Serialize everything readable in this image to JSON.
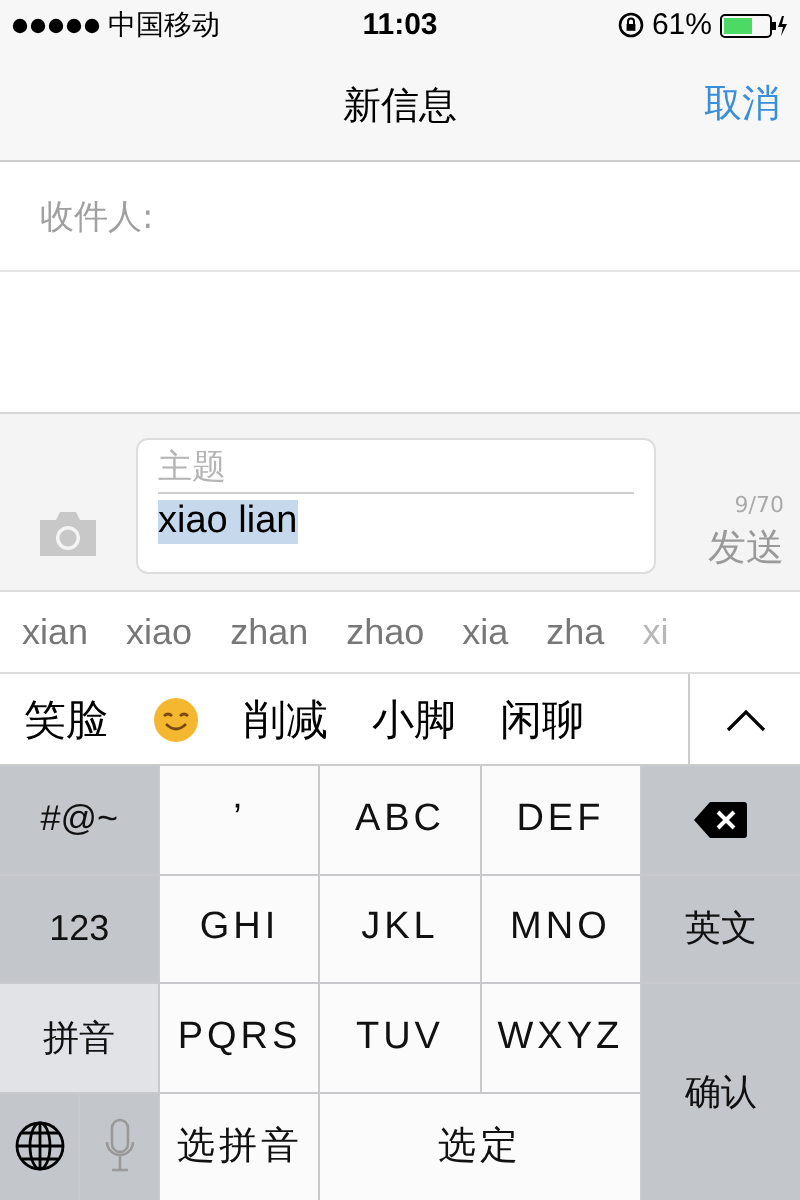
{
  "status_bar": {
    "carrier": "中国移动",
    "time": "11:03",
    "battery": "61%"
  },
  "nav": {
    "title": "新信息",
    "cancel": "取消"
  },
  "recipient": {
    "label": "收件人:"
  },
  "compose": {
    "subject_placeholder": "主题",
    "text": "xiao lian",
    "counter": "9/70",
    "send": "发送",
    "send_disabled": true
  },
  "pinyin_options": [
    "xian",
    "xiao",
    "zhan",
    "zhao",
    "xia",
    "zha",
    "xi"
  ],
  "candidates": [
    {
      "kind": "text",
      "text": "笑脸"
    },
    {
      "kind": "emoji"
    },
    {
      "kind": "text",
      "text": "削减"
    },
    {
      "kind": "text",
      "text": "小脚"
    },
    {
      "kind": "text",
      "text": "闲聊"
    }
  ],
  "keys": [
    {
      "kind": "function",
      "label": "#@~",
      "selected": false
    },
    {
      "kind": "letter",
      "label": "’",
      "selected": false
    },
    {
      "kind": "letter",
      "label": "ABC",
      "selected": false
    },
    {
      "kind": "letter",
      "label": "DEF",
      "selected": false
    },
    {
      "kind": "delete",
      "selected": false
    },
    {
      "kind": "function",
      "label": "123",
      "selected": false
    },
    {
      "kind": "letter",
      "label": "GHI",
      "selected": false
    },
    {
      "kind": "letter",
      "label": "JKL",
      "selected": false
    },
    {
      "kind": "letter",
      "label": "MNO",
      "selected": false
    },
    {
      "kind": "function",
      "label": "英文",
      "selected": false
    },
    {
      "kind": "function",
      "label": "拼音",
      "selected": true
    },
    {
      "kind": "letter",
      "label": "PQRS",
      "selected": false
    },
    {
      "kind": "letter",
      "label": "TUV",
      "selected": false
    },
    {
      "kind": "letter",
      "label": "WXYZ",
      "selected": false
    },
    {
      "kind": "confirm",
      "label": "确认",
      "selected": false
    },
    {
      "kind": "globe",
      "selected": false
    },
    {
      "kind": "mic",
      "selected": false
    },
    {
      "kind": "letter",
      "label": "选拼音",
      "selected": false
    },
    {
      "kind": "space",
      "label": "选定",
      "selected": false
    }
  ]
}
